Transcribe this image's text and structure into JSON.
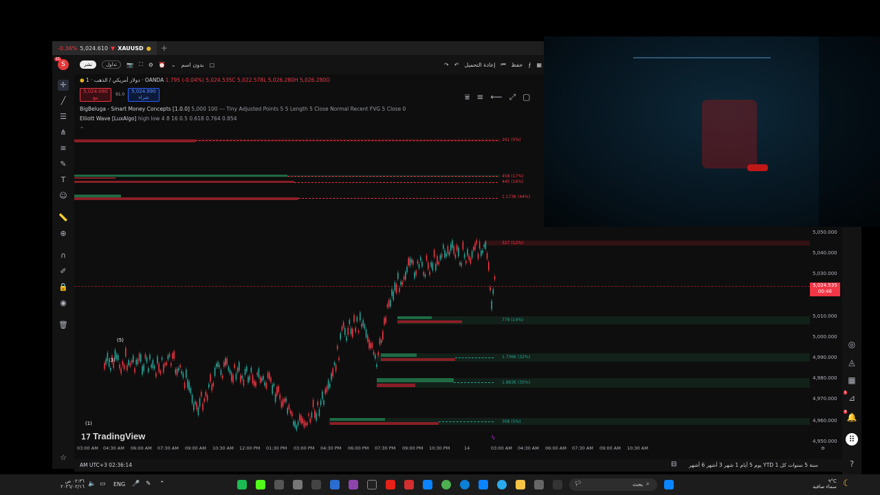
{
  "tab": {
    "change": "-0.36% ",
    "price": "5,024.610",
    "symbol": "XAUUSD",
    "add": "+"
  },
  "toolbar": {
    "publish": "نشر",
    "trade": "تداول",
    "untitled": "بدون اسم",
    "redo_label": "إعادة التحميل",
    "save": "حفظ",
    "avatar_letter": "S",
    "avatar_badge": "11"
  },
  "legend": {
    "title": "دولار أمريكي / الذهب · 1 · OANDA",
    "ohlc": "1.795 (-0.04%) 5,024.535C 5,022.578L 5,026.280H 5,026.280O",
    "sell_price": "5,024.080",
    "sell_label": "بيع",
    "spread": "91.0",
    "buy_price": "5,024.990",
    "buy_label": "شراء",
    "ind1_name": "BigBeluga - Smart Money Concepts [1.0.0]",
    "ind1_params": "5,000 100 --- Tiny Adjusted Points 5 5 Length 5 Close Normal Recent FVG 5 Close 0",
    "ind2_name": "Elliott Wave [LuxAlgo]",
    "ind2_params": "high low 4 8 16 0.5 0.618 0.764 0.854"
  },
  "zones": [
    {
      "label": "261 (5%)",
      "color": "#f23645"
    },
    {
      "label": "458 (17%)",
      "color": "#f23645"
    },
    {
      "label": "445 (16%)",
      "color": "#f23645"
    },
    {
      "label": "1.173K (44%)",
      "color": "#f23645"
    },
    {
      "label": "327 (12%)",
      "color": "#f23645"
    },
    {
      "label": "779 (14%)",
      "color": "#26a69a"
    },
    {
      "label": "1.736K (32%)",
      "color": "#26a69a"
    },
    {
      "label": "1.883K (35%)",
      "color": "#26a69a"
    },
    {
      "label": "308 (5%)",
      "color": "#26a69a"
    }
  ],
  "waves": [
    "(5)",
    "(3)",
    "(1)"
  ],
  "price_axis": [
    "5,050.000",
    "5,040.000",
    "5,030.000",
    "5,010.000",
    "5,000.000",
    "4,990.000",
    "4,980.000",
    "4,970.000",
    "4,960.000",
    "4,950.000"
  ],
  "current_price": {
    "price": "5,024.535",
    "countdown": "00:46"
  },
  "time_axis": [
    "03:00 AM",
    "04:30 AM",
    "06:00 AM",
    "07:30 AM",
    "09:00 AM",
    "10:30 AM",
    "12:00 PM",
    "01:30 PM",
    "03:00 PM",
    "04:30 PM",
    "06:00 PM",
    "07:30 PM",
    "09:00 PM",
    "10:30 PM",
    "14",
    "03:00 AM",
    "04:30 AM",
    "06:00 AM",
    "07:30 AM",
    "09:00 AM",
    "10:30 AM"
  ],
  "bottom": {
    "clock": "AM UTC+3 02:36:14",
    "ranges": "يوم  5 أيام  1 شهر  3 أشهر  6 أشهر  YTD  1 سنة  5 سنوات  كل"
  },
  "watermark": "TradingView",
  "taskbar": {
    "search": "بحث",
    "lang": "ENG",
    "time": "٠٢:٣٦ ص",
    "date": "٢٠٢٦/٠٢/١٦",
    "weather_temp": "٩°C",
    "weather_text": "سماء صافية"
  },
  "colors": {
    "up": "#26a69a",
    "down": "#f23645",
    "bg": "#0e0e0e"
  }
}
